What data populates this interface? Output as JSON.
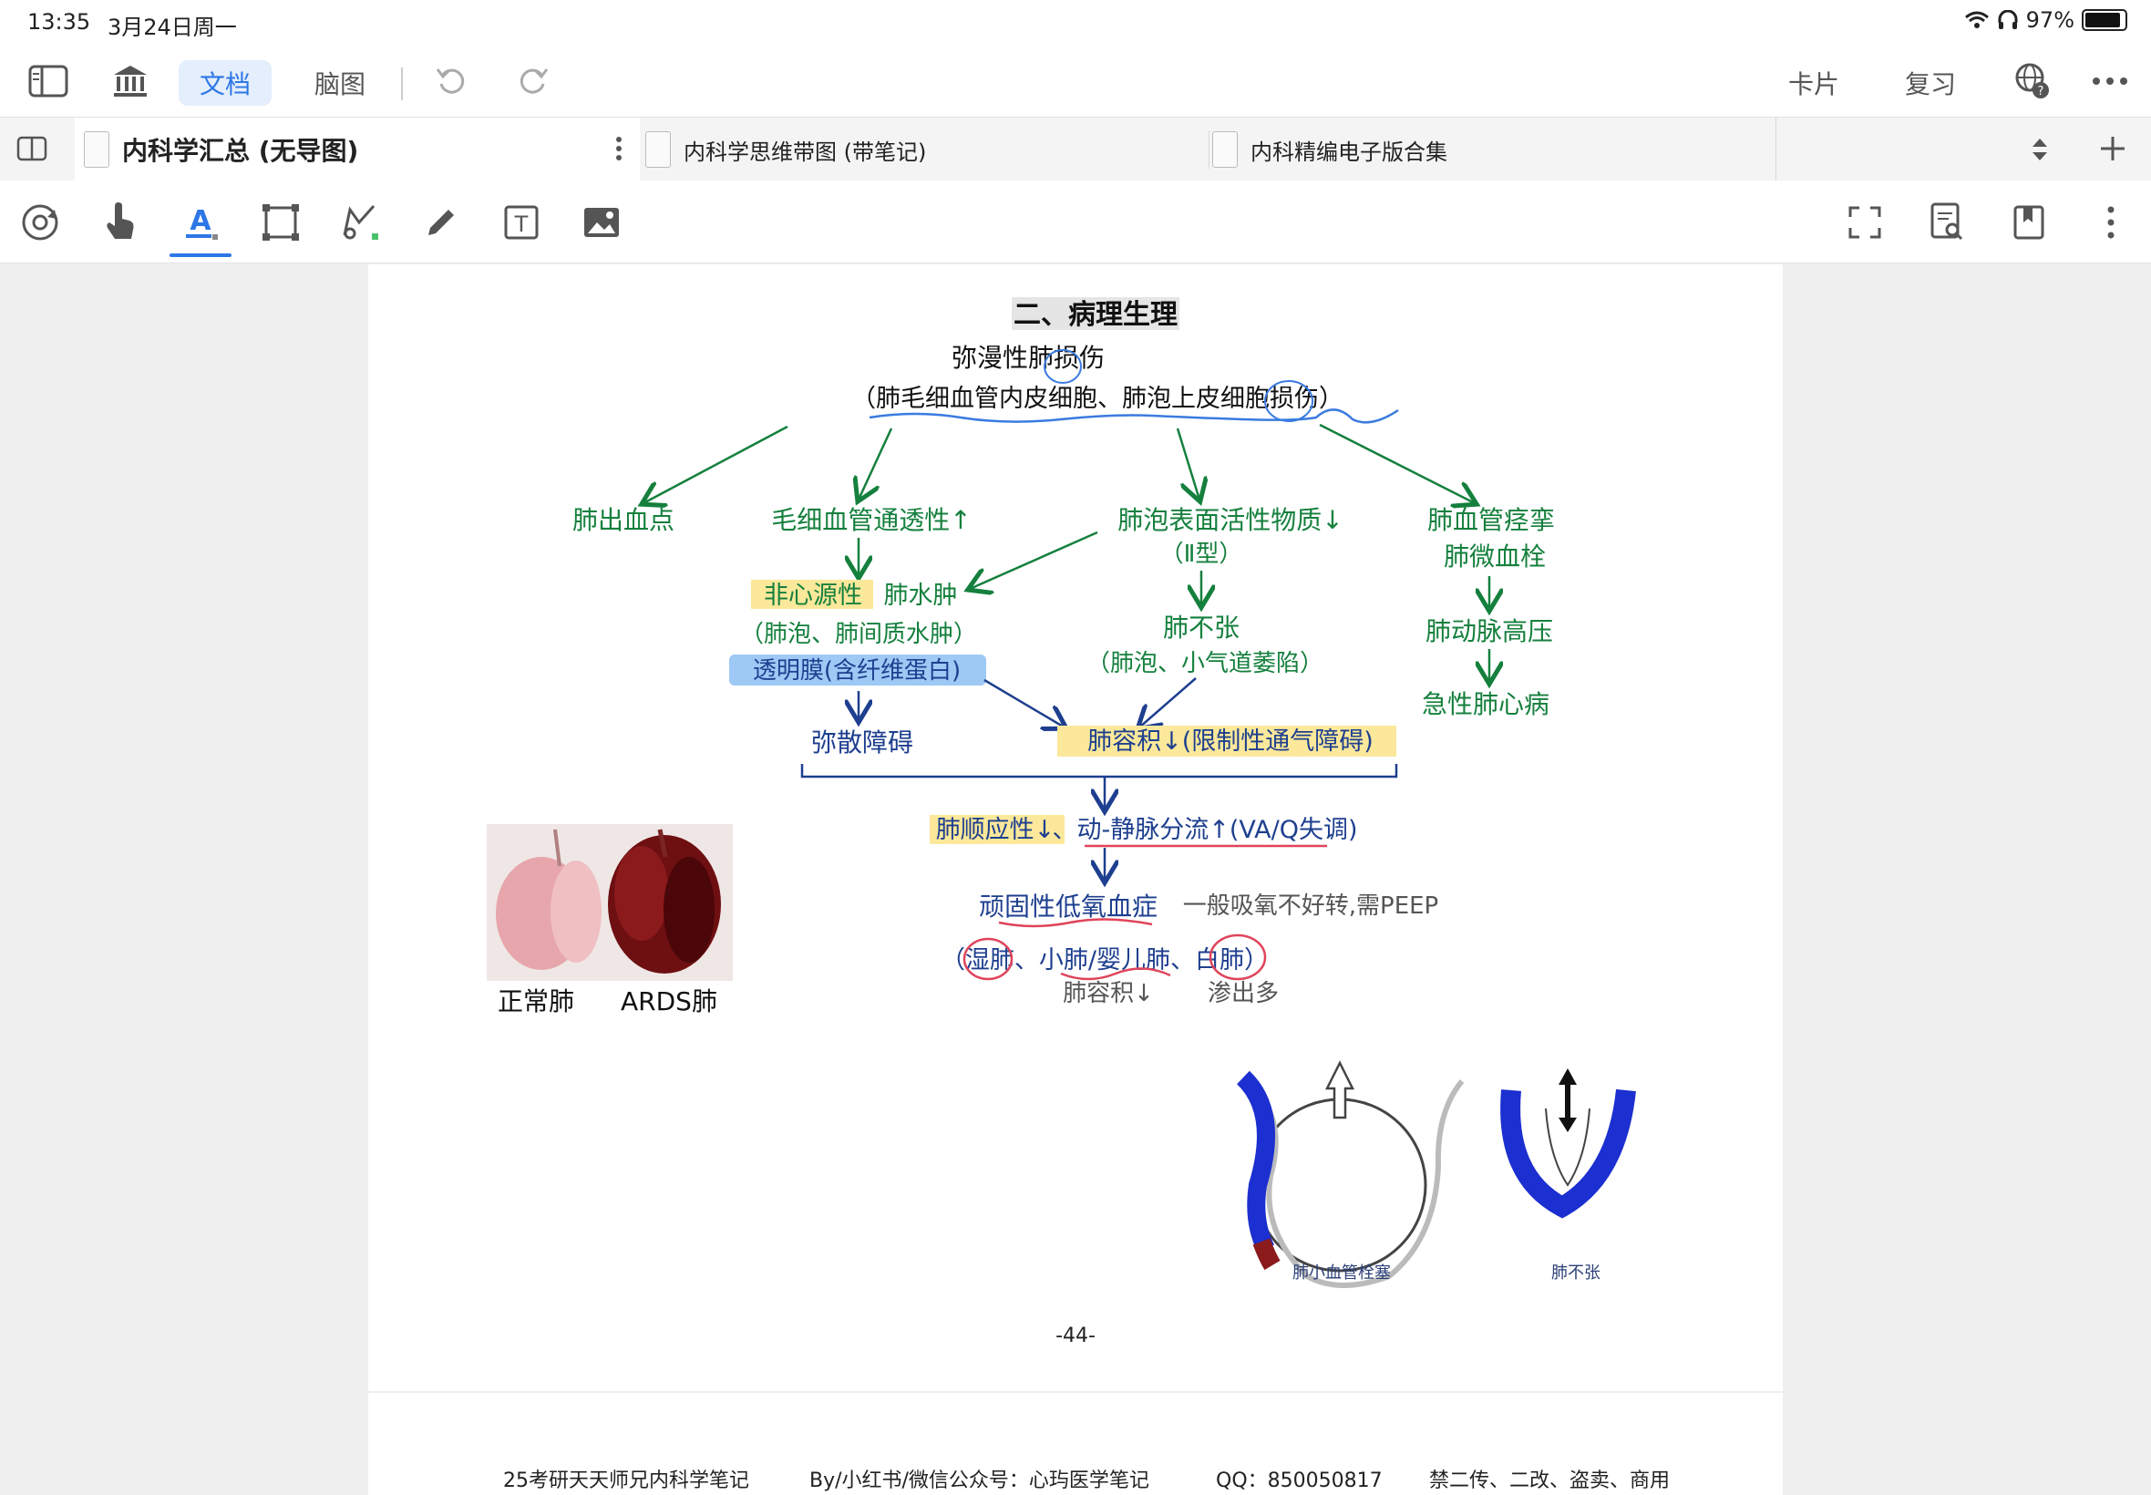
{
  "status": {
    "time": "13:35",
    "date": "3月24日周一",
    "battery": "97%"
  },
  "topbar": {
    "tab_doc": "文档",
    "tab_mindmap": "脑图",
    "card": "卡片",
    "review": "复习"
  },
  "tabs": [
    {
      "label": "内科学汇总 (无导图)"
    },
    {
      "label": "内科学思维带图 (带笔记)"
    },
    {
      "label": "内科精编电子版合集"
    }
  ],
  "page": {
    "section_title": "二、病理生理",
    "root_line1": "弥漫性肺损伤",
    "root_line2": "（肺毛细血管内皮细胞、肺泡上皮细胞损伤）",
    "n_hemorrhage": "肺出血点",
    "n_permeability": "毛细血管通透性↑",
    "n_surfactant1": "肺泡表面活性物质↓",
    "n_surfactant2": "（Ⅱ型）",
    "n_spasm1": "肺血管痉挛",
    "n_spasm2": "肺微血栓",
    "n_edema_hl": "非心源性",
    "n_edema_rest": "肺水肿",
    "n_edema2": "（肺泡、肺间质水肿）",
    "n_membrane": "透明膜(含纤维蛋白)",
    "n_atelectasis1": "肺不张",
    "n_atelectasis2": "（肺泡、小气道萎陷）",
    "n_pah": "肺动脉高压",
    "n_acp": "急性肺心病",
    "n_diffusion": "弥散障碍",
    "n_volume": "肺容积↓(限制性通气障碍)",
    "n_compliance_hl": "肺顺应性↓",
    "n_shunt": "、动-静脉分流↑(VA/Q失调)",
    "n_hypoxemia": "顽固性低氧血症",
    "n_oxygen": "一般吸氧不好转,需PEEP",
    "n_lungs": "（湿肺、小肺/婴儿肺、白肺）",
    "n_lungvol": "肺容积↓",
    "n_exudate": "渗出多",
    "img_normal": "正常肺",
    "img_ards": "ARDS肺",
    "cap_embolism": "肺小血管栓塞",
    "cap_atelectasis": "肺不张",
    "page_number": "-44-"
  },
  "footer": {
    "f1": "25考研天天师兄内科学笔记",
    "f2": "By/小红书/微信公众号：心玙医学笔记",
    "f3": "QQ：850050817",
    "f4": "禁二传、二改、盗卖、商用"
  },
  "colors": {
    "accent": "#2d77e6",
    "green": "#15803d",
    "navy": "#1e3f8f",
    "highlight": "#fbe89a",
    "blue_hl": "#9ec9f5",
    "red_ink": "#e0445a"
  }
}
